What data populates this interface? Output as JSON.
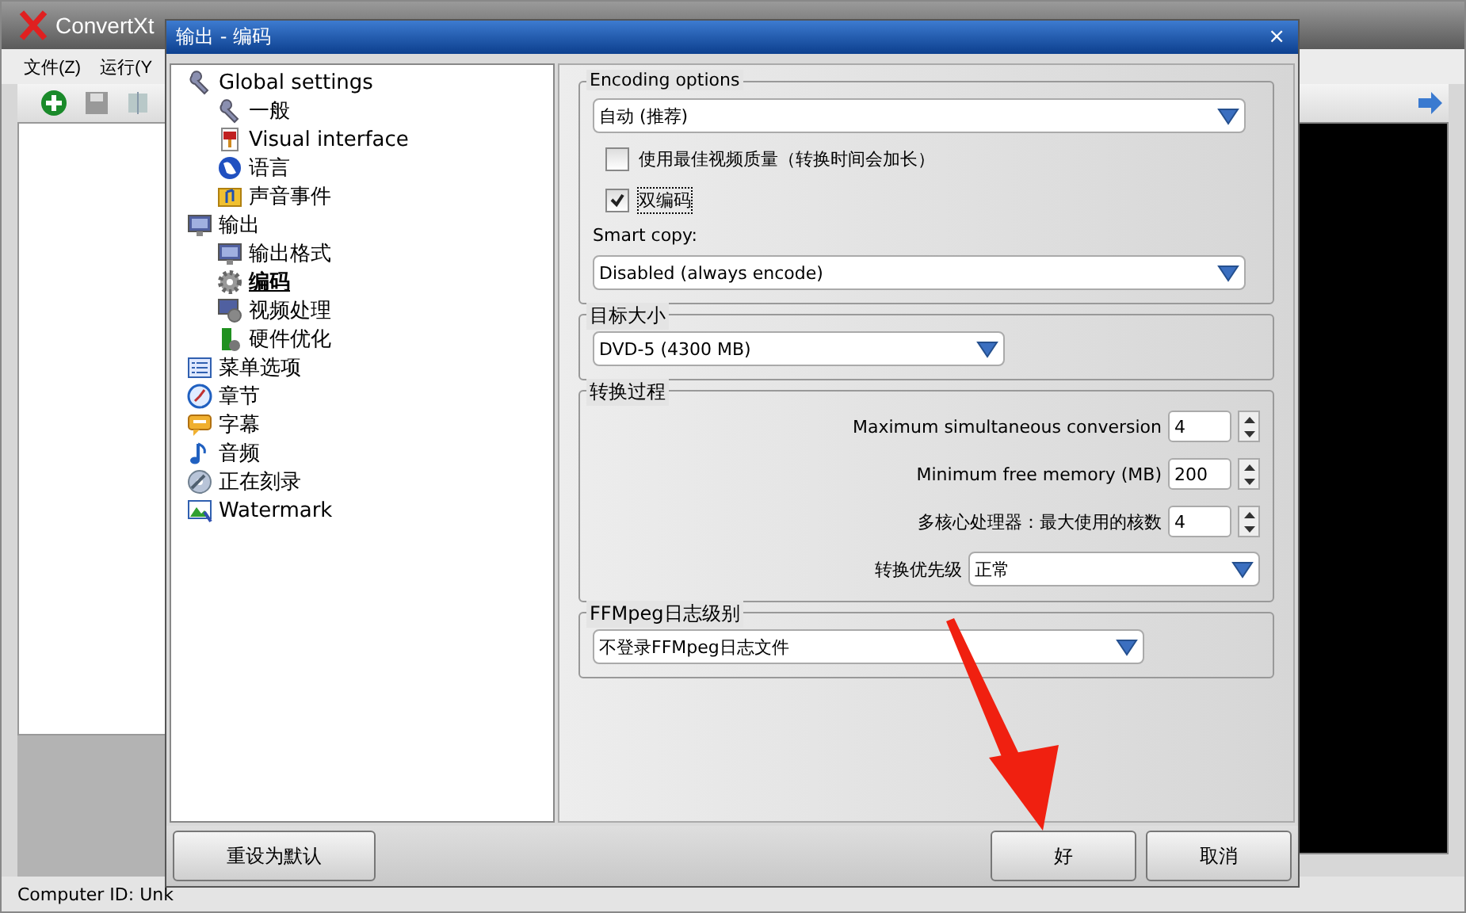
{
  "main_window": {
    "title": "ConvertXt",
    "menu": [
      "文件(Z)",
      "运行(Y"
    ],
    "status_bar": "Computer ID: Unk"
  },
  "dialog": {
    "title": "输出 - 编码",
    "close": "×",
    "tree": [
      {
        "label": "Global settings",
        "selected": false,
        "children": [
          {
            "label": "一般",
            "selected": false
          },
          {
            "label": "Visual interface",
            "selected": false
          },
          {
            "label": "语言",
            "selected": false
          },
          {
            "label": "声音事件",
            "selected": false
          }
        ]
      },
      {
        "label": "输出",
        "selected": false,
        "children": [
          {
            "label": "输出格式",
            "selected": false
          },
          {
            "label": "编码",
            "selected": true
          },
          {
            "label": "视频处理",
            "selected": false
          },
          {
            "label": "硬件优化",
            "selected": false
          }
        ]
      },
      {
        "label": "菜单选项",
        "selected": false
      },
      {
        "label": "章节",
        "selected": false
      },
      {
        "label": "字幕",
        "selected": false
      },
      {
        "label": "音频",
        "selected": false
      },
      {
        "label": "正在刻录",
        "selected": false
      },
      {
        "label": "Watermark",
        "selected": false
      }
    ],
    "groups": [
      {
        "title": "Encoding options",
        "rows": [
          {
            "kind": "select",
            "value": "自动 (推荐)"
          },
          {
            "kind": "checkbox",
            "label": "使用最佳视频质量（转换时间会加长）",
            "checked": false
          },
          {
            "kind": "checkbox",
            "label": "双编码",
            "checked": true
          },
          {
            "kind": "label",
            "label": "Smart copy:"
          },
          {
            "kind": "select",
            "value": "Disabled (always encode)"
          }
        ]
      },
      {
        "title": "目标大小",
        "rows": [
          {
            "kind": "short-select",
            "value": "DVD-5 (4300 MB)"
          }
        ]
      },
      {
        "title": "转换过程",
        "rows": [
          {
            "kind": "spin",
            "label": "Maximum simultaneous conversion",
            "value": "4"
          },
          {
            "kind": "spin",
            "label": "Minimum free memory (MB)",
            "value": "200"
          },
          {
            "kind": "spin",
            "label": "多核心处理器：最大使用的核数",
            "value": "4"
          },
          {
            "kind": "labeled-select",
            "label": "转换优先级",
            "value": "正常"
          }
        ]
      },
      {
        "title": "FFMpeg日志级别",
        "rows": [
          {
            "kind": "medium-select",
            "value": "不登录FFMpeg日志文件"
          }
        ]
      }
    ],
    "buttons": {
      "reset": "重设为默认",
      "ok": "好",
      "cancel": "取消"
    }
  }
}
